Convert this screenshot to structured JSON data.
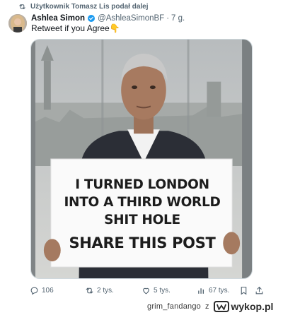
{
  "retweet": {
    "text": "Użytkownik Tomasz Lis podał dalej"
  },
  "tweet": {
    "author_name": "Ashlea Simon",
    "handle": "@AshleaSimonBF",
    "separator": "·",
    "time": "7 g.",
    "text": "Retweet if you Agree👇"
  },
  "sign": {
    "line1_a": "I TURNED ",
    "line1_b": "LONDON",
    "line2_a": "INTO A ",
    "line2_b": "THIRD WORLD",
    "line3": "SHIT HOLE",
    "line4": "SHARE THIS POST"
  },
  "actions": {
    "replies": "106",
    "retweets": "2 tys.",
    "likes": "5 tys.",
    "views": "67 tys."
  },
  "watermark": {
    "user": "grim_fandango",
    "gender": "z",
    "site": "wykop.pl"
  },
  "colors": {
    "verified": "#1d9bf0",
    "muted": "#536471",
    "text": "#0f1419"
  },
  "icons": [
    "retweet-icon",
    "verified-badge-icon",
    "reply-icon",
    "like-icon",
    "views-icon",
    "bookmark-icon",
    "share-icon",
    "wykop-logo-icon"
  ]
}
